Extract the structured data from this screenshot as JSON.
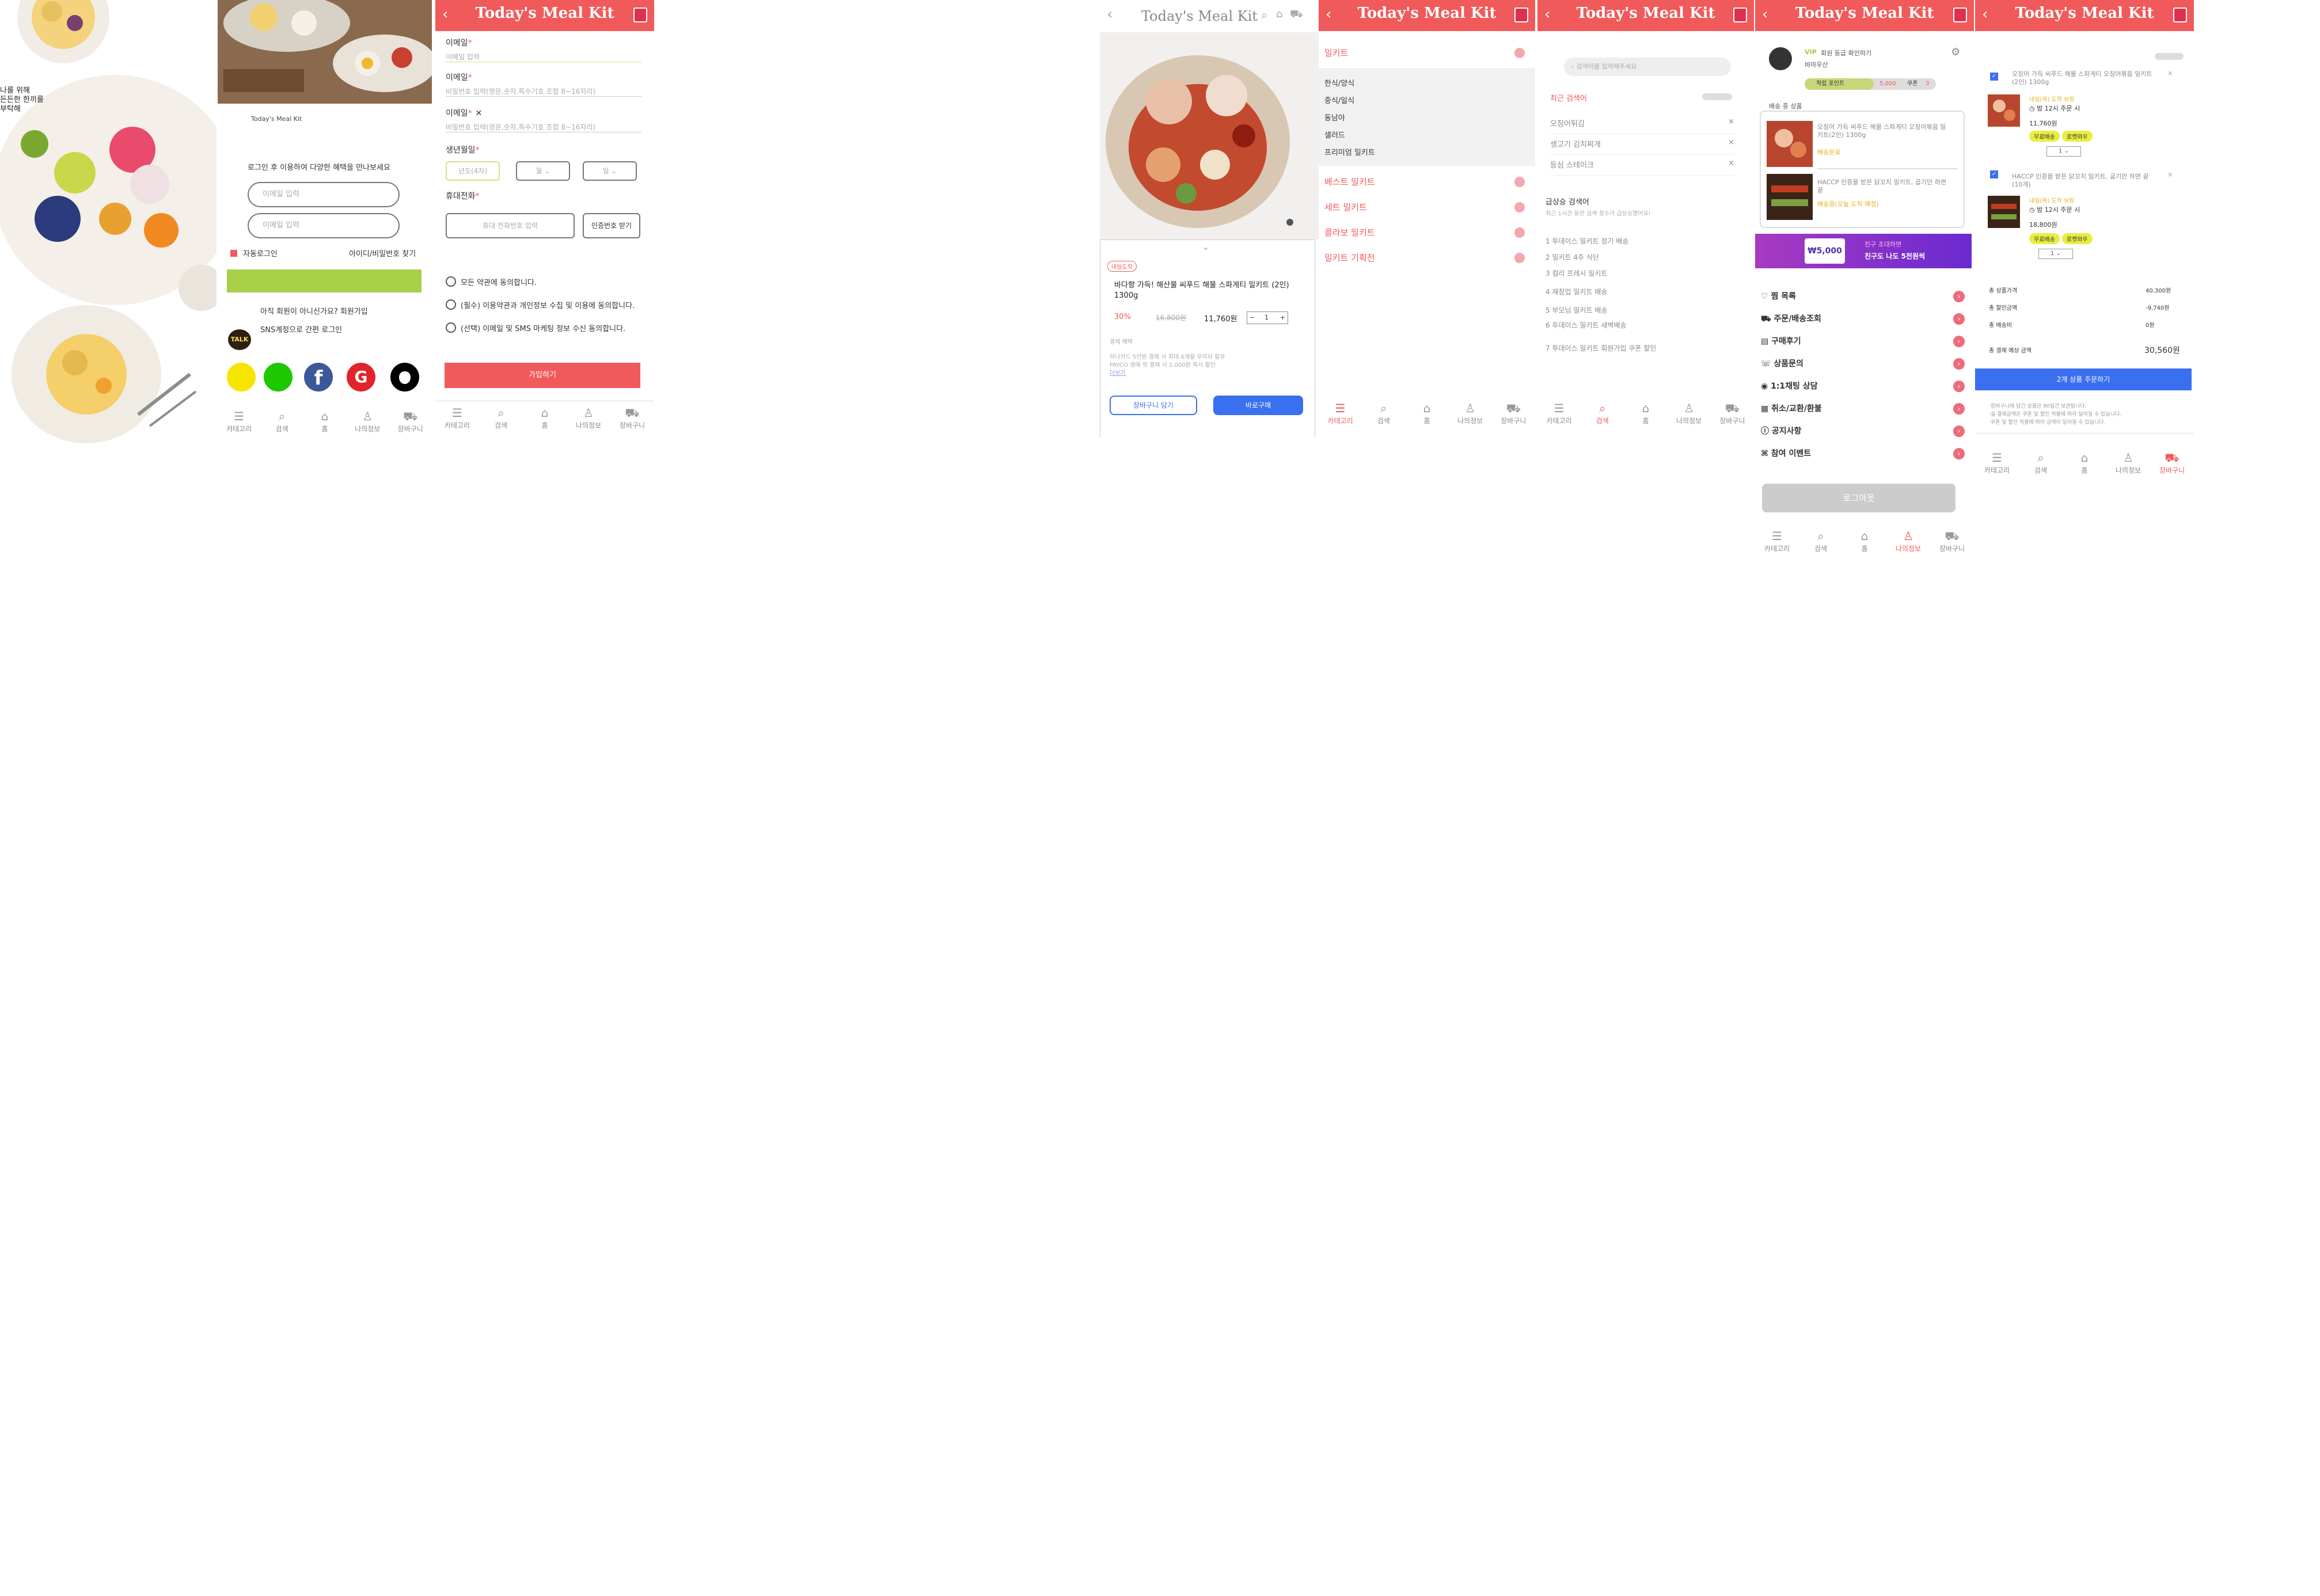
{
  "brand": {
    "name": "Today's Meal Kit",
    "accent": "#f05a5a",
    "green": "#a8d048",
    "blue": "#3a6ff0"
  },
  "nav": {
    "items": [
      "카테고리",
      "검색",
      "홈",
      "나의정보",
      "장바구니"
    ]
  },
  "splash": {
    "lines": [
      "나를 위해",
      "든든한 한끼를",
      "부탁해"
    ]
  },
  "login": {
    "logo_text": "Today's Meal Kit",
    "heading": "로그인 후 이용하여 다양한 혜택을 만나보세요",
    "id_placeholder": "이메일 입력",
    "pw_placeholder": "이메일 입력",
    "auto_login": "자동로그인",
    "find_link": "아이디/비밀번호 찾기",
    "signup_prompt": "아직 회원이 아니신가요? 회원가입",
    "sns_label": "SNS계정으로 간편 로그인",
    "talk_badge": "TALK"
  },
  "signup": {
    "email_label": "이메일",
    "email_placeholder": "이메일 입력",
    "pw_label": "이메일",
    "pw_placeholder": "비밀번호 입력(영문,숫자,특수기호 조합 8~16자리)",
    "pw2_label": "이메일",
    "pw2_placeholder": "비밀번호 입력(영문,숫자,특수기호 조합 8~16자리)",
    "birth_label": "생년월일",
    "birth_year": "년도(4자)",
    "birth_month": "월",
    "birth_day": "일",
    "phone_label": "휴대전화",
    "phone_placeholder": "휴대 전화번호 입력",
    "verify_button": "인증번호 받기",
    "agree_all": "모든 약관에 동의합니다.",
    "agree_required": "(필수) 이용약관과 개인정보 수집 및 이용에 동의합니다.",
    "agree_optional": "(선택) 이메일 및 SMS 마케팅 정보 수신 동의합니다.",
    "submit": "가입하기"
  },
  "product": {
    "header_title": "Today's Meal Kit",
    "badge": "내일도착",
    "name": "바다향 가득! 해산물 씨푸드 해물 스파게티 밀키트 (2인) 1300g",
    "discount": "30%",
    "original_price": "16,800원",
    "price": "11,760원",
    "qty": "1",
    "shipping_label": "결제 혜택",
    "shipping_desc1": "하나카드 5만원 결제 시 최대 6개월 무이자 할부",
    "shipping_desc2": "PAYCO 생애 첫 결제 시 2,000원 즉시 할인",
    "more": "더보기",
    "cart_button": "장바구니 담기",
    "buy_button": "바로구매"
  },
  "category": {
    "top": "밀키트",
    "subs": [
      "한식/양식",
      "중식/일식",
      "동남아",
      "샐러드",
      "프리미엄 밀키트"
    ],
    "sections": [
      "베스트 밀키트",
      "세트 밀키트",
      "콜라보 밀키트",
      "밀키트 기획전"
    ]
  },
  "search": {
    "placeholder": "검색어를 입력해주세요",
    "recent_label": "최근 검색어",
    "recent": [
      "오징어튀김",
      "생고기 김치찌개",
      "등심 스테이크"
    ],
    "trend_label": "급상승 검색어",
    "trend_sub": "최근 1시간 동안 검색 횟수가 급상승했어요!",
    "trends": [
      "1 투데이스 밀키트 정기 배송",
      "2 밀키트 4주 식단",
      "3 컬리 프레시 밀키트",
      "4 재창업 밀키트 배송",
      "5 부모님 밀키트 배송",
      "6 투데이스 밀키트 새벽배송",
      "7 투데이스 밀키트 회원가입 쿠폰 할인"
    ]
  },
  "mypage": {
    "grade": "VIP",
    "grade_link": "회원 등급 확인하기",
    "user": "바마우산",
    "points_label": "적립 포인트",
    "points": "5,000",
    "coupon_label": "쿠폰",
    "coupon": "3",
    "delivering": "배송 중 상품",
    "items": [
      {
        "name": "오징어 가득 씨푸드 해물 스파게티 오징어볶음 밀키트(2인) 1300g",
        "status": "배송완료"
      },
      {
        "name": "HACCP 인증을 받은 닭꼬치 밀키트, 곱기만 하면 끝",
        "status": "배송중(오늘 도착 예정)"
      }
    ],
    "banner_amount": "5,000",
    "banner_sub": "친구 초대하면",
    "banner_main": "친구도 나도 5천원씩",
    "menu": [
      "찜 목록",
      "주문/배송조회",
      "구매후기",
      "상품문의",
      "1:1채팅 상담",
      "취소/교환/환불",
      "공지사항",
      "참여 이벤트"
    ],
    "logout": "로그아웃"
  },
  "cart": {
    "items": [
      {
        "name": "오징어 가득 씨푸드 해물 스파게티 오징어볶음 밀키트(2인) 1300g",
        "ship": "내일(목) 도착 보장",
        "time": "밤 12시 주문 시",
        "price": "11,760원",
        "qty": "1"
      },
      {
        "name": "HACCP 인증을 받은 닭꼬치 밀키트, 굽기만 하면 끝(10개)",
        "ship": "내일(목) 도착 보장",
        "time": "밤 12시 주문 시",
        "price": "18,800원",
        "qty": "1"
      }
    ],
    "tags": [
      "무료배송",
      "로켓와우"
    ],
    "total_label": "총 상품가격",
    "total": "40,300원",
    "discount_label": "총 할인금액",
    "discount": "-9,740원",
    "ship_label": "총 배송비",
    "ship": "0원",
    "pay_label": "총 결제 예상 금액",
    "pay": "30,560원",
    "order_button": "2개 상품 주문하기",
    "notice1": "·장바구니에 담긴 상품은 90일간 보관됩니다.",
    "notice2": "·실 결제금액은 쿠폰 및 할인 적용에 따라 달라질 수 있습니다.",
    "notice3": "·쿠폰 및 할인 적용에 따라 금액이 달라질 수 있습니다."
  }
}
